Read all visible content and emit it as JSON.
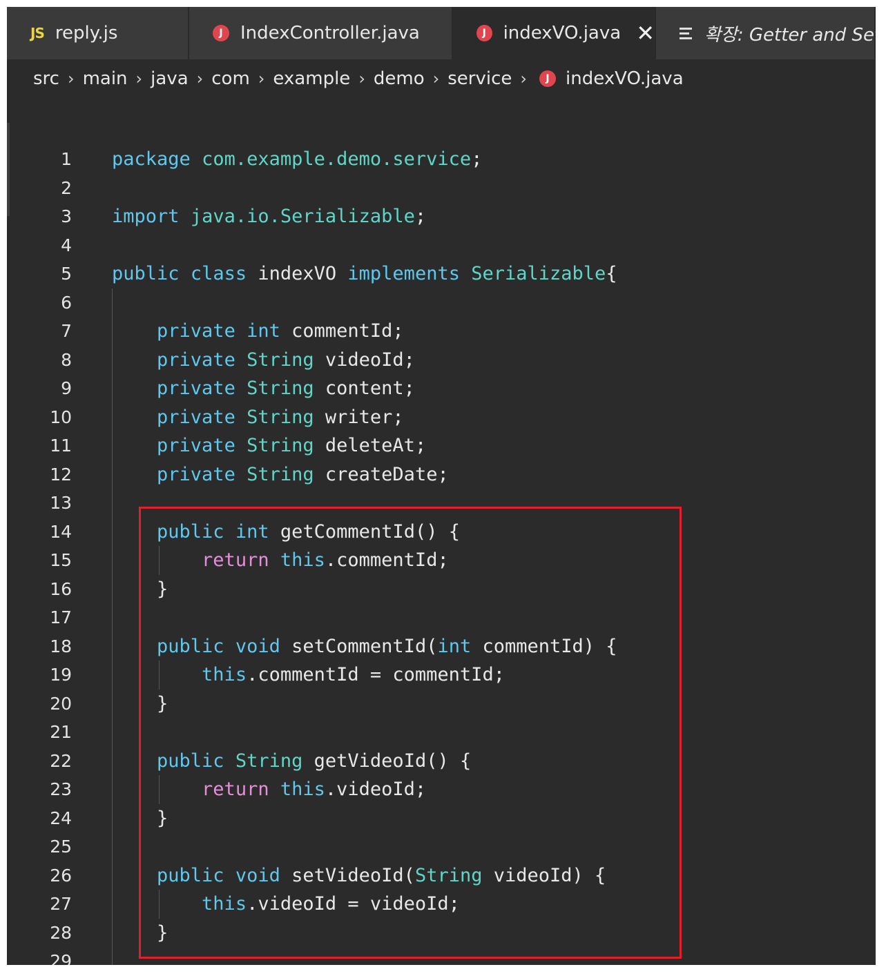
{
  "tabs": [
    {
      "label": "reply.js",
      "icon": "JS",
      "active": false
    },
    {
      "label": "IndexController.java",
      "icon": "J",
      "active": false
    },
    {
      "label": "indexVO.java",
      "icon": "J",
      "active": true,
      "close": "✕"
    },
    {
      "label": "확장: Getter and Set",
      "icon": "outline",
      "active": false
    }
  ],
  "breadcrumb": [
    "src",
    "main",
    "java",
    "com",
    "example",
    "demo",
    "service"
  ],
  "breadcrumb_file": "indexVO.java",
  "code_lines": [
    {
      "n": "1",
      "text": "package com.example.demo.service;"
    },
    {
      "n": "2",
      "text": ""
    },
    {
      "n": "3",
      "text": "import java.io.Serializable;"
    },
    {
      "n": "4",
      "text": ""
    },
    {
      "n": "5",
      "text": "public class indexVO implements Serializable{"
    },
    {
      "n": "6",
      "text": ""
    },
    {
      "n": "7",
      "text": "    private int commentId;"
    },
    {
      "n": "8",
      "text": "    private String videoId;"
    },
    {
      "n": "9",
      "text": "    private String content;"
    },
    {
      "n": "10",
      "text": "    private String writer;"
    },
    {
      "n": "11",
      "text": "    private String deleteAt;"
    },
    {
      "n": "12",
      "text": "    private String createDate;"
    },
    {
      "n": "13",
      "text": ""
    },
    {
      "n": "14",
      "text": "    public int getCommentId() {"
    },
    {
      "n": "15",
      "text": "        return this.commentId;"
    },
    {
      "n": "16",
      "text": "    }"
    },
    {
      "n": "17",
      "text": ""
    },
    {
      "n": "18",
      "text": "    public void setCommentId(int commentId) {"
    },
    {
      "n": "19",
      "text": "        this.commentId = commentId;"
    },
    {
      "n": "20",
      "text": "    }"
    },
    {
      "n": "21",
      "text": ""
    },
    {
      "n": "22",
      "text": "    public String getVideoId() {"
    },
    {
      "n": "23",
      "text": "        return this.videoId;"
    },
    {
      "n": "24",
      "text": "    }"
    },
    {
      "n": "25",
      "text": ""
    },
    {
      "n": "26",
      "text": "    public void setVideoId(String videoId) {"
    },
    {
      "n": "27",
      "text": "        this.videoId = videoId;"
    },
    {
      "n": "28",
      "text": "    }"
    },
    {
      "n": "29",
      "text": ""
    }
  ],
  "colors": {
    "keyword": "#5fc8ee",
    "control": "#e58fd8",
    "type": "#5fd7c8",
    "text": "#e8e8e8",
    "highlight_border": "#e0202a",
    "java_icon": "#e0464e",
    "js_icon": "#e8d44d"
  }
}
